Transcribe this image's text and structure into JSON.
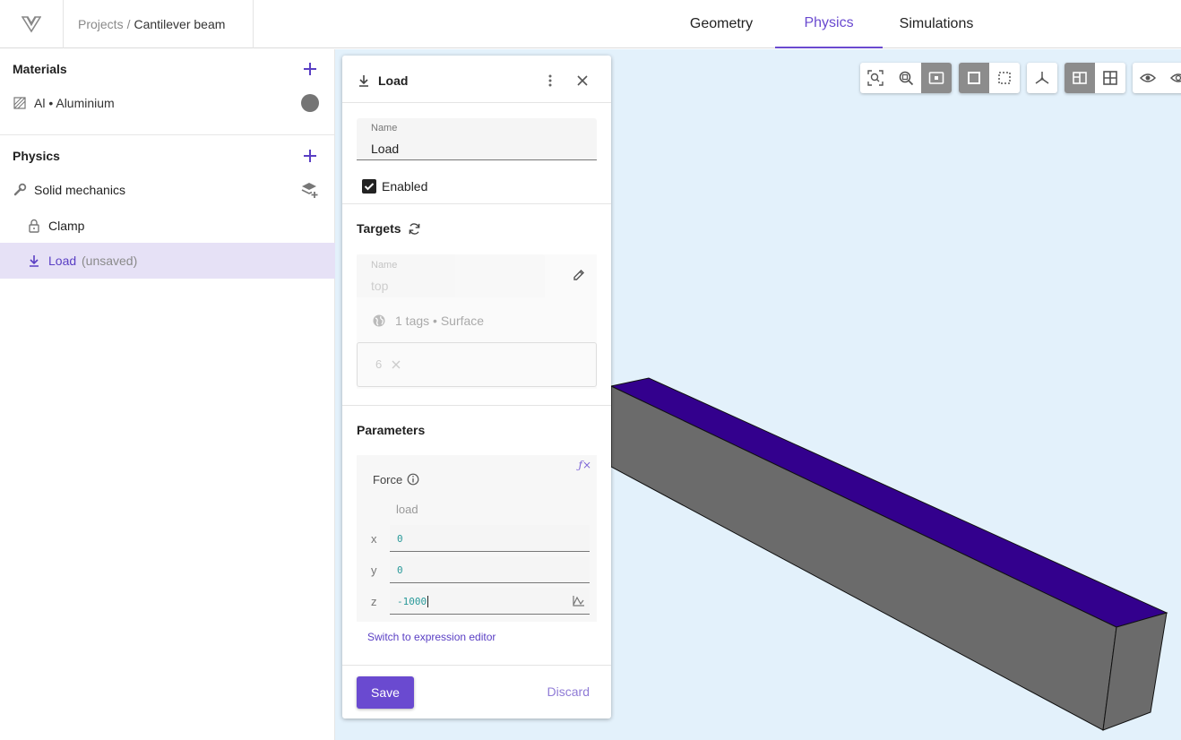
{
  "breadcrumb": {
    "root": "Projects",
    "separator": "/",
    "current": "Cantilever beam"
  },
  "nav": {
    "tabs": [
      {
        "label": "Geometry"
      },
      {
        "label": "Physics"
      },
      {
        "label": "Simulations"
      }
    ],
    "active": "Physics"
  },
  "sidebar": {
    "materials": {
      "title": "Materials",
      "items": [
        {
          "label": "Al • Aluminium",
          "swatch_color": "#757575"
        }
      ]
    },
    "physics": {
      "title": "Physics",
      "items": [
        {
          "label": "Solid mechanics"
        },
        {
          "label": "Clamp"
        },
        {
          "label": "Load",
          "suffix": "(unsaved)"
        }
      ]
    }
  },
  "panel": {
    "title": "Load",
    "name_label": "Name",
    "name_value": "Load",
    "enabled_label": "Enabled",
    "enabled": true,
    "targets": {
      "title": "Targets",
      "name_label": "Name",
      "name_value": "top",
      "tags_summary": "1 tags • Surface",
      "chip_label": "6"
    },
    "parameters": {
      "title": "Parameters",
      "force_label": "Force",
      "force_expression": "load",
      "components": [
        {
          "axis": "x",
          "value": "0"
        },
        {
          "axis": "y",
          "value": "0"
        },
        {
          "axis": "z",
          "value": "-1000"
        }
      ],
      "switch_link": "Switch to expression editor"
    },
    "save_label": "Save",
    "discard_label": "Discard"
  },
  "colors": {
    "accent": "#6a4ad0",
    "viewport_bg": "#e3f1fb",
    "beam_side": "#6b6b6b",
    "beam_top": "#33008d"
  }
}
